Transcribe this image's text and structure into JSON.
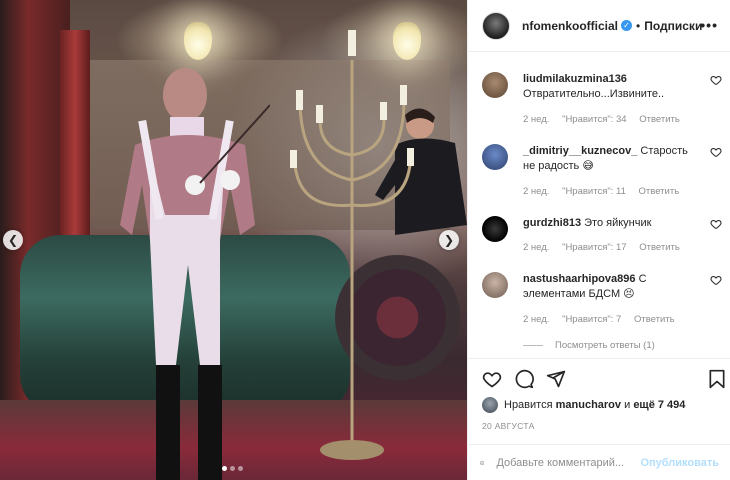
{
  "header": {
    "username": "nfomenkoofficial",
    "separator": "•",
    "follow_label": "Подписки",
    "more_label": "•••"
  },
  "comments": [
    {
      "user": "liudmilakuzmina136",
      "text": "Отвратительно...Извините..",
      "time": "2 нед.",
      "likes": "\"Нравится\": 34",
      "reply": "Ответить"
    },
    {
      "user": "_dimitriy__kuznecov_",
      "text": "Старость не радость 😅",
      "time": "2 нед.",
      "likes": "\"Нравится\": 11",
      "reply": "Ответить"
    },
    {
      "user": "gurdzhi813",
      "text": "Это яйкунчик",
      "time": "2 нед.",
      "likes": "\"Нравится\": 17",
      "reply": "Ответить"
    },
    {
      "user": "nastushaarhipova896",
      "text": "С элементами БДСМ 😣",
      "time": "2 нед.",
      "likes": "\"Нравится\": 7",
      "reply": "Ответить"
    }
  ],
  "replies_label": "Посмотреть ответы (1)",
  "likes": {
    "prefix": "Нравится",
    "user": "manucharov",
    "middle": "и",
    "count": "ещё 7 494"
  },
  "date": "20 АВГУСТА",
  "comment_input": {
    "placeholder": "Добавьте комментарий...",
    "publish_label": "Опубликовать"
  },
  "carousel": {
    "total": 3,
    "active": 1
  },
  "colors": {
    "accent": "#3897f0",
    "publish_disabled": "#b2dffc",
    "muted": "#8e8e8e",
    "text": "#262626"
  }
}
